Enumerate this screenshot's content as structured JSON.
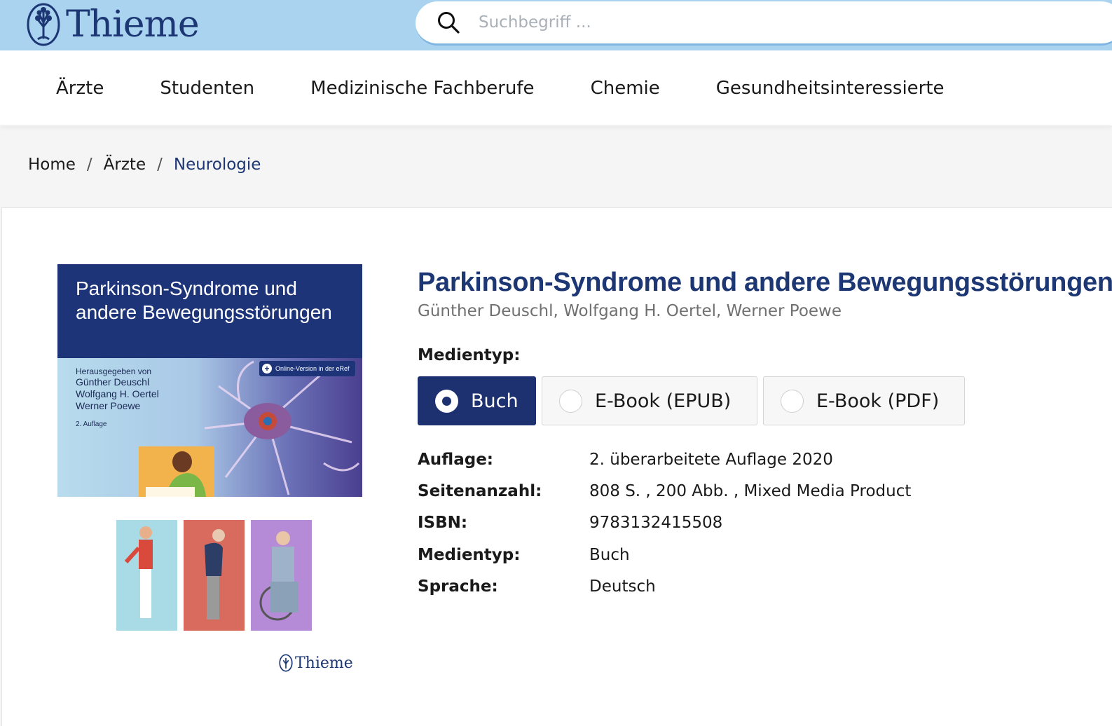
{
  "header": {
    "logo_text": "Thieme",
    "search_placeholder": "Suchbegriff ..."
  },
  "nav": {
    "items": [
      "Ärzte",
      "Studenten",
      "Medizinische Fachberufe",
      "Chemie",
      "Gesundheitsinteressierte"
    ]
  },
  "breadcrumb": {
    "items": [
      "Home",
      "Ärzte",
      "Neurologie"
    ],
    "separator": "/"
  },
  "cover": {
    "title_line1": "Parkinson-Syndrome und",
    "title_line2": "andere Bewegungsstörungen",
    "editors_label": "Herausgegeben von",
    "editors": [
      "Günther Deuschl",
      "Wolfgang H. Oertel",
      "Werner Poewe"
    ],
    "edition": "2. Auflage",
    "online_badge": "Online-Version in der eRef",
    "publisher": "Thieme"
  },
  "product": {
    "title": "Parkinson-Syndrome und andere Bewegungsstörungen",
    "authors": "Günther Deuschl, Wolfgang H. Oertel, Werner Poewe",
    "media_label": "Medientyp:",
    "media_options": [
      "Buch",
      "E-Book (EPUB)",
      "E-Book (PDF)"
    ],
    "media_selected": "Buch",
    "details": [
      {
        "key": "Auflage:",
        "value": "2. überarbeitete Auflage 2020"
      },
      {
        "key": "Seitenanzahl:",
        "value": "808 S. , 200 Abb. , Mixed Media Product"
      },
      {
        "key": "ISBN:",
        "value": "9783132415508"
      },
      {
        "key": "Medientyp:",
        "value": "Buch"
      },
      {
        "key": "Sprache:",
        "value": "Deutsch"
      }
    ]
  },
  "colors": {
    "brand_blue": "#1c3773",
    "header_bg": "#a9d3ef",
    "selected_bg": "#1d3070"
  }
}
